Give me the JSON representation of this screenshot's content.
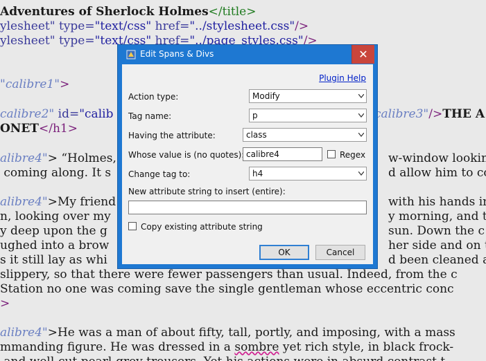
{
  "editor": {
    "l1a": "Adventures of Sherlock Holmes",
    "l1b": "</title>",
    "l2a": "ylesheet\"",
    "l2b": " type=",
    "l2c": "\"text/css\"",
    "l2d": " href=",
    "l2e": "\"../stylesheet.css\"",
    "l2f": "/>",
    "l3a": "ylesheet\"",
    "l3b": " type=",
    "l3c": "\"text/css\"",
    "l3d": " href=",
    "l3e": "\"../page_styles.css\"",
    "l3f": "/>",
    "l4a": "\"calibre1\"",
    "l4b": ">",
    "l5a": "calibre2\"",
    "l5b": " id=",
    "l5c": "\"calib",
    "l5r1": "calibre3\"",
    "l5r2": "/>",
    "l5r3": "THE A",
    "l6a": "ONET",
    "l6b": "</h1>",
    "l7a": "alibre4\"",
    "l7b": "> “Holmes,",
    "l7r": "w-window lookin",
    "l8a": " coming along. It s",
    "l8r": "d allow him to co",
    "l9a": "alibre4\"",
    "l9b": ">My friend",
    "l9r": "with his hands in",
    "l10a": "n, looking over my",
    "l10r": "y morning, and t",
    "l11a": "y deep upon the g",
    "l11r": "sun. Down the c",
    "l12a": "ughed into a brow",
    "l12r": "her side and on th",
    "l13a": "s it still lay as whi",
    "l13r": "d been cleaned a",
    "l14": "slippery, so that there were fewer passengers than usual. Indeed, from the c",
    "l15": "Station no one was coming save the single gentleman whose eccentric conc",
    "l16": ">",
    "l17a": "alibre4\"",
    "l17b": ">He was a man of about fifty, tall, portly, and imposing, with a mass",
    "l18a": "mmanding figure. He was dressed in a ",
    "l18b": "sombre",
    "l18c": " yet rich style, in black frock-",
    "l19": " and well-cut pearl-grey trousers. Yet his actions were in absurd contrast t"
  },
  "dialog": {
    "title": "Edit Spans & Divs",
    "close_glyph": "✕",
    "plugin_help": "Plugin Help",
    "action_type_label": "Action type:",
    "action_type_value": "Modify",
    "tag_name_label": "Tag name:",
    "tag_name_value": "p",
    "having_attr_label": "Having the attribute:",
    "having_attr_value": "class",
    "whose_value_label": "Whose value is (no quotes):",
    "whose_value_value": "calibre4",
    "regex_label": "Regex",
    "regex_checked": false,
    "change_tag_label": "Change tag to:",
    "change_tag_value": "h4",
    "new_attr_label": "New attribute string to insert (entire):",
    "new_attr_value": "",
    "copy_existing_label": "Copy existing attribute string",
    "copy_existing_checked": false,
    "ok_label": "OK",
    "cancel_label": "Cancel",
    "icon": "plugin-icon"
  },
  "colors": {
    "dialog_frame": "#1e78d2",
    "close_button": "#c9453c",
    "editor_background": "#e9e9e9"
  }
}
